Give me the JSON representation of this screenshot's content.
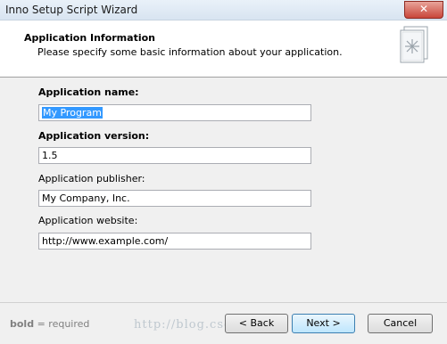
{
  "window": {
    "title": "Inno Setup Script Wizard",
    "close_label": "✕"
  },
  "header": {
    "title": "Application Information",
    "subtitle": "Please specify some basic information about your application.",
    "icon": "wizard-page-icon"
  },
  "fields": [
    {
      "label": "Application name:",
      "bold": true,
      "value": "My Program",
      "selected": true
    },
    {
      "label": "Application version:",
      "bold": true,
      "value": "1.5"
    },
    {
      "label": "Application publisher:",
      "bold": false,
      "value": "My Company, Inc."
    },
    {
      "label": "Application website:",
      "bold": false,
      "value": "http://www.example.com/"
    }
  ],
  "footer": {
    "note_bold": "bold",
    "note_rest": " = required",
    "back_label": "< Back",
    "next_label": "Next >",
    "cancel_label": "Cancel",
    "watermark": "http://blog.csdn.net/"
  }
}
